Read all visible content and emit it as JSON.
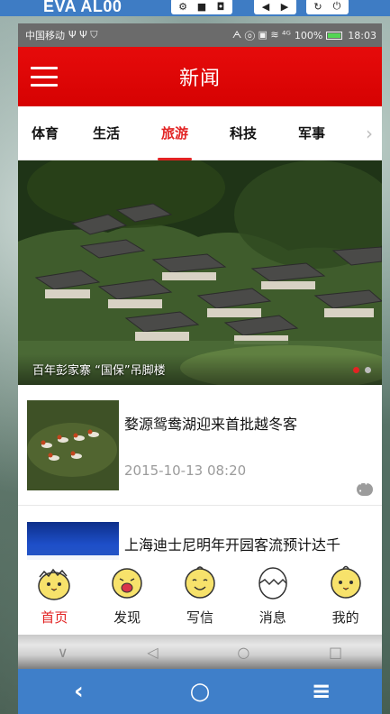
{
  "emulator": {
    "title": "EVA AL00",
    "buttons_group1": [
      "⚙",
      "■",
      "◘"
    ],
    "buttons_group2": [
      "◀",
      "▶"
    ],
    "buttons_group3": [
      "↻",
      "⏻"
    ],
    "bottom_keys": [
      "‹",
      "○",
      "≡"
    ]
  },
  "status_bar": {
    "carrier": "中国移动",
    "left_icons": "Ψ Ψ ⛉",
    "right_icons": "ᗅ ⓞ ▣ ≋ ⁴ᴳ",
    "battery": "100%",
    "time": "18:03"
  },
  "app_bar": {
    "title": "新闻"
  },
  "tabs": {
    "items": [
      "体育",
      "生活",
      "旅游",
      "科技",
      "军事"
    ],
    "active_index": 2,
    "more_icon": "›"
  },
  "banner": {
    "caption": "百年彭家寨 “国保”吊脚楼",
    "dots": 2,
    "active_dot": 0
  },
  "news": [
    {
      "title": "婺源鸳鸯湖迎来首批越冬客",
      "time": "2015-10-13 08:20"
    },
    {
      "title": "上海迪士尼明年开园客流预计达千"
    }
  ],
  "bottom_nav": {
    "items": [
      "首页",
      "发现",
      "写信",
      "消息",
      "我的"
    ],
    "active_index": 0
  },
  "softkeys": [
    "∨",
    "◁",
    "○",
    "□"
  ],
  "colors": {
    "accent": "#e22323",
    "app_bar": "#d60202",
    "emulator_blue": "#3e7cc4"
  }
}
